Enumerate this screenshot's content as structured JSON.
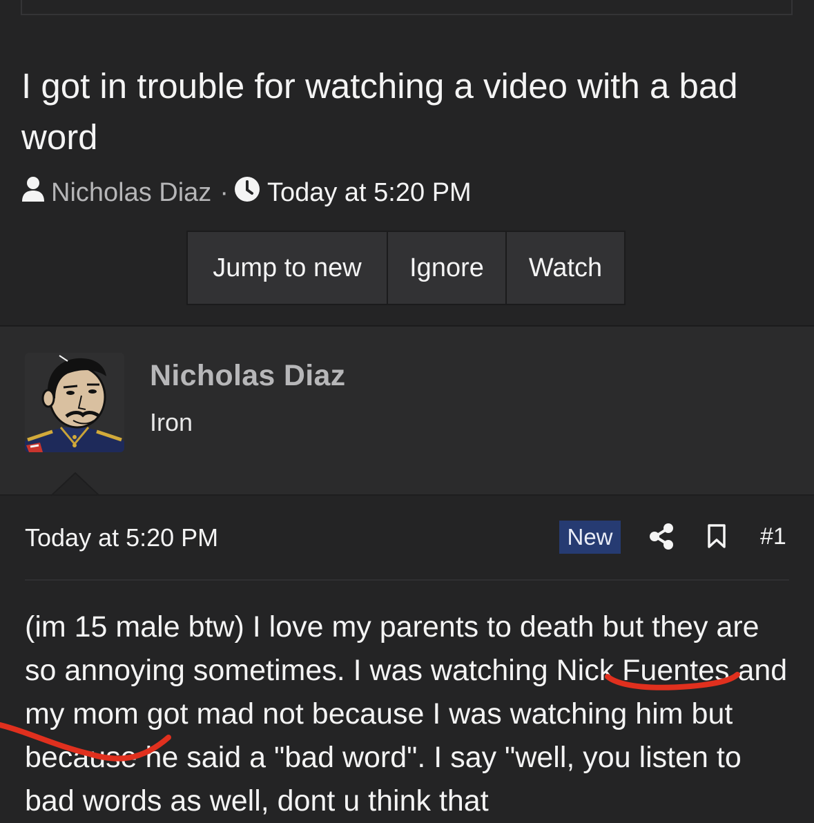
{
  "thread": {
    "title": "I got in trouble for watching a video with a bad word",
    "author": "Nicholas Diaz",
    "separator": "·",
    "date": "Today at 5:20 PM"
  },
  "actions": {
    "jump_to_new": "Jump to new",
    "ignore": "Ignore",
    "watch": "Watch"
  },
  "post": {
    "user_name": "Nicholas Diaz",
    "user_title": "Iron",
    "date": "Today at 5:20 PM",
    "badge": "New",
    "number": "#1",
    "body": "(im 15 male btw) I love my parents to death but they are so annoying sometimes. I was watching Nick Fuentes and my mom got mad not because I was watching him but because he said a \"bad word\". I say \"well, you listen to bad words as well, dont u think that"
  },
  "icons": {
    "author": "user-icon",
    "date": "clock-icon",
    "share": "share-icon",
    "bookmark": "bookmark-icon"
  },
  "colors": {
    "background": "#242425",
    "user_section": "#2b2b2c",
    "badge": "#263b72",
    "annotation": "#e0301e"
  }
}
